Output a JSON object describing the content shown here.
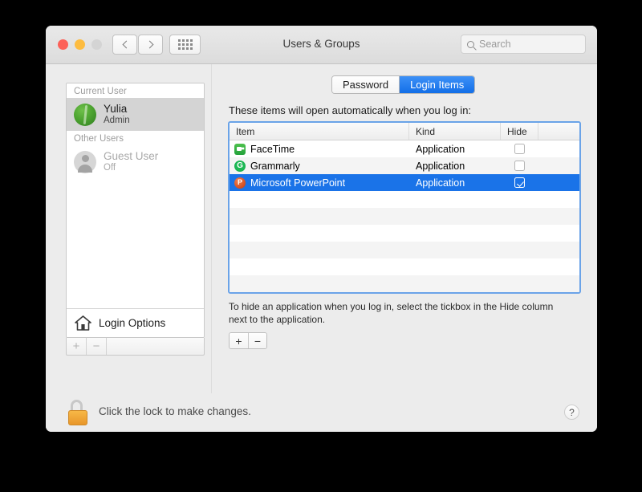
{
  "window": {
    "title": "Users & Groups",
    "traffic": {
      "close": "close-button",
      "minimize": "minimize-button",
      "zoom": "zoom-button"
    },
    "nav": {
      "back": "back-button",
      "forward": "forward-button",
      "grid": "show-all-button"
    },
    "search": {
      "placeholder": "Search"
    }
  },
  "sidebar": {
    "groups": [
      {
        "header": "Current User",
        "users": [
          {
            "name": "Yulia",
            "role": "Admin",
            "selected": true,
            "avatar": "photo-avatar"
          }
        ]
      },
      {
        "header": "Other Users",
        "users": [
          {
            "name": "Guest User",
            "role": "Off",
            "selected": false,
            "avatar": "guest-avatar"
          }
        ]
      }
    ],
    "login_options": {
      "label": "Login Options",
      "icon": "house-icon"
    },
    "buttons": {
      "add": "+",
      "remove": "−"
    }
  },
  "content": {
    "tabs": [
      {
        "label": "Password",
        "active": false
      },
      {
        "label": "Login Items",
        "active": true
      }
    ],
    "intro": "These items will open automatically when you log in:",
    "table": {
      "columns": [
        "Item",
        "Kind",
        "Hide"
      ],
      "rows": [
        {
          "item": "FaceTime",
          "icon": "facetime-icon",
          "kind": "Application",
          "hide": false,
          "selected": false
        },
        {
          "item": "Grammarly",
          "icon": "grammarly-icon",
          "kind": "Application",
          "hide": false,
          "selected": false
        },
        {
          "item": "Microsoft PowerPoint",
          "icon": "powerpoint-icon",
          "kind": "Application",
          "hide": true,
          "selected": true
        }
      ],
      "empty_row_count": 7
    },
    "hint": "To hide an application when you log in, select the tickbox in the Hide column next to the application.",
    "buttons": {
      "add": "+",
      "remove": "−"
    }
  },
  "footer": {
    "lock_text": "Click the lock to make changes.",
    "lock_icon": "unlocked-padlock-icon",
    "help_label": "?"
  },
  "colors": {
    "selection_blue": "#1a73e8",
    "tab_active_blue": "#2b81f0",
    "focus_ring": "#6aa3e8",
    "lock_gold": "#f0a637"
  }
}
